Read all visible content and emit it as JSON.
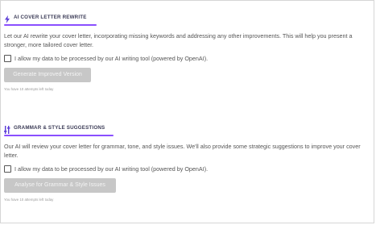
{
  "sections": [
    {
      "title": "AI COVER LETTER REWRITE",
      "icon": "lightning-icon",
      "description": "Let our AI rewrite your cover letter, incorporating missing keywords and addressing any other improvements. This will help you present a stronger, more tailored cover letter.",
      "consent_label": "I allow my data to be processed by our AI writing tool (powered by OpenAI).",
      "button_label": "Generate Improved Version",
      "attempts_text": "You have 10 attempts left today"
    },
    {
      "title": "GRAMMAR & STYLE SUGGESTIONS",
      "icon": "sliders-icon",
      "description": "Our AI will review your cover letter for grammar, tone, and style issues. We'll also provide some strategic suggestions to improve your cover letter.",
      "consent_label": "I allow my data to be processed by our AI writing tool (powered by OpenAI).",
      "button_label": "Analyse for Grammar & Style Issues",
      "attempts_text": "You have 10 attempts left today"
    }
  ],
  "colors": {
    "accent": "#8a4fff",
    "button_disabled": "#c7c7c7",
    "text": "#555555"
  }
}
